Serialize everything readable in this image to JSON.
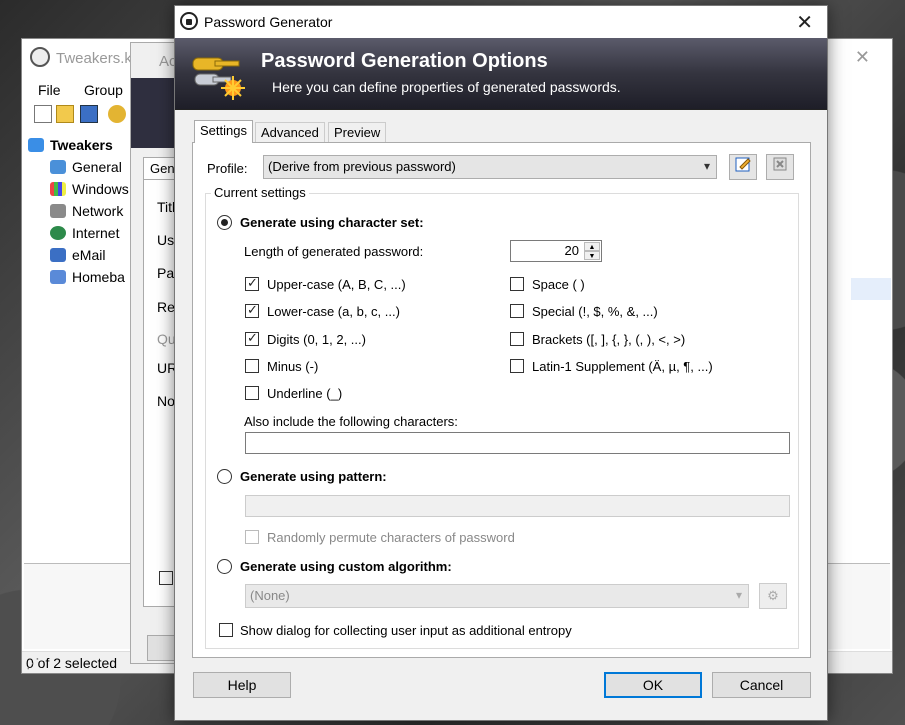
{
  "main_window": {
    "title": "Tweakers.kc",
    "menu": [
      "File",
      "Group"
    ],
    "tree": {
      "root": "Tweakers",
      "items": [
        "General",
        "Windows",
        "Network",
        "Internet",
        "eMail",
        "Homeba"
      ]
    },
    "status": "0 of 2 selected"
  },
  "entry_window": {
    "title": "Ac",
    "tab": "Gen",
    "labels": [
      "Titl",
      "Us",
      "Pa",
      "Re",
      "Qu",
      "UR",
      "No"
    ]
  },
  "dialog": {
    "title": "Password Generator",
    "banner_title": "Password Generation Options",
    "banner_subtitle": "Here you can define properties of generated passwords.",
    "tabs": [
      "Settings",
      "Advanced",
      "Preview"
    ],
    "profile_label": "Profile:",
    "profile_value": "(Derive from previous password)",
    "group_title": "Current settings",
    "charset_radio": "Generate using character set:",
    "length_label": "Length of generated password:",
    "length_value": "20",
    "checkboxes_left": [
      {
        "label": "Upper-case (A, B, C, ...)",
        "checked": true
      },
      {
        "label": "Lower-case (a, b, c, ...)",
        "checked": true
      },
      {
        "label": "Digits (0, 1, 2, ...)",
        "checked": true
      },
      {
        "label": "Minus (-)",
        "checked": false
      },
      {
        "label": "Underline (_)",
        "checked": false
      }
    ],
    "checkboxes_right": [
      {
        "label": "Space ( )",
        "checked": false
      },
      {
        "label": "Special (!, $, %, &, ...)",
        "checked": false
      },
      {
        "label": "Brackets ([, ], {, }, (, ), <, >)",
        "checked": false
      },
      {
        "label": "Latin-1 Supplement (Ä, µ, ¶, ...)",
        "checked": false
      }
    ],
    "also_include_label": "Also include the following characters:",
    "also_include_value": "",
    "pattern_radio": "Generate using pattern:",
    "pattern_value": "",
    "permute_label": "Randomly permute characters of password",
    "custom_radio": "Generate using custom algorithm:",
    "custom_value": "(None)",
    "entropy_label": "Show dialog for collecting user input as additional entropy",
    "help_button": "Help",
    "ok_button": "OK",
    "cancel_button": "Cancel"
  }
}
